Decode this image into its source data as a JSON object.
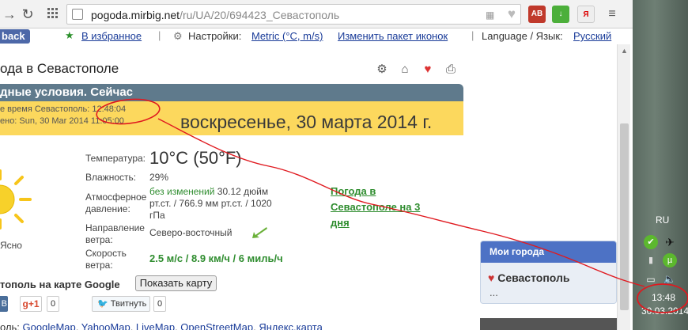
{
  "browser": {
    "url_domain": "pogoda.mirbig.net",
    "url_path": "/ru/UA/20/694423_Севастополь",
    "extensions": [
      "AB",
      "↓",
      "Я"
    ]
  },
  "bookmarks": {
    "back": "back",
    "favorites": "В избранное",
    "settings_prefix": "Настройки:",
    "settings_value": "Metric (°C, m/s)",
    "change_icons": "Изменить пакет иконок",
    "language_prefix": "Language / Язык:",
    "language_value": "Русский",
    "separator": "|"
  },
  "page": {
    "title": "ода в Севастополе",
    "conditions_header": "дные условия. Сейчас",
    "local_time": "е время Севастополь: 12:48:04",
    "updated": "ено: Sun, 30 Mar 2014 11:05:00",
    "big_date": "воскресенье, 30 марта 2014 г.",
    "clear_label": "Ясно"
  },
  "weather": {
    "temperature_label": "Температура:",
    "temperature_value": "10°C (50°F)",
    "humidity_label": "Влажность:",
    "humidity_value": "29%",
    "pressure_label_1": "Атмосферное",
    "pressure_label_2": "давление:",
    "pressure_change": "без изменений",
    "pressure_value_1": "30.12 дюйм",
    "pressure_value_2": "рт.ст. / 766.9 мм рт.ст. / 1020",
    "pressure_value_3": "гПа",
    "wind_dir_label_1": "Направление",
    "wind_dir_label_2": "ветра:",
    "wind_dir_value": "Северо-восточный",
    "wind_speed_label_1": "Скорость",
    "wind_speed_label_2": "ветра:",
    "wind_speed_value": "2.5 м/с / 8.9 км/ч / 6 миль/ч",
    "forecast_link": "Погода в Севастополе на 3 дня"
  },
  "map": {
    "label": "тополь на карте Google",
    "button": "Показать карту",
    "links_prefix": "оль:",
    "links": [
      "GoogleMap",
      "YahooMap",
      "LiveMap",
      "OpenStreetMap",
      "Яндекс.карта"
    ]
  },
  "social": {
    "vk": "В",
    "gplus": "g+1",
    "gplus_count": "0",
    "tweet": "Твитнуть",
    "tweet_count": "0"
  },
  "mycities": {
    "header": "Мои города",
    "city": "Севастополь",
    "more": "..."
  },
  "tray": {
    "lang": "RU",
    "time": "13:48",
    "date": "30.03.2014"
  },
  "colors": {
    "panel_header": "#5f7a8c",
    "panel_yellow": "#fcd85d",
    "annotation_red": "#e0191f",
    "link_green": "#2f8d2f",
    "mycities_header": "#4d72c5"
  }
}
